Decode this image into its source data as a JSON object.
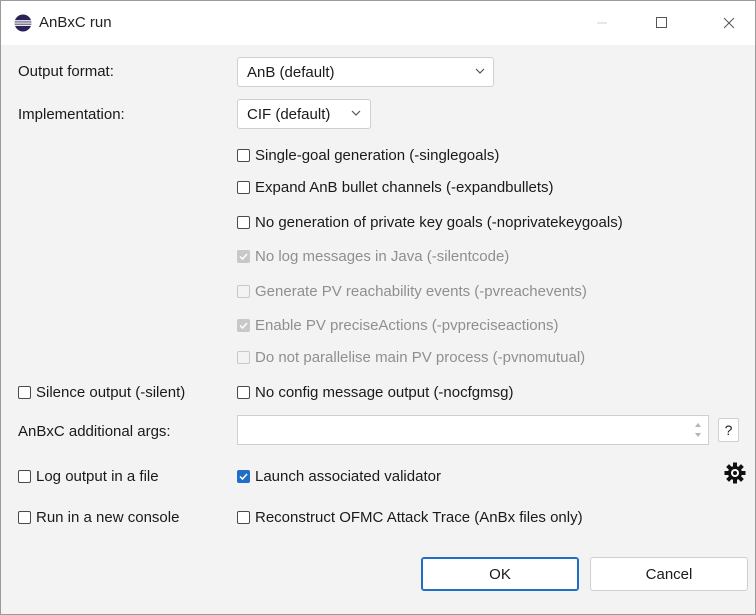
{
  "window": {
    "title": "AnBxC run",
    "icon": "eclipse-icon",
    "controls": [
      "minimize-icon",
      "maximize-icon",
      "close-icon"
    ]
  },
  "form": {
    "output_format": {
      "label": "Output format:",
      "value": "AnB (default)"
    },
    "implementation": {
      "label": "Implementation:",
      "value": "CIF (default)"
    },
    "options": [
      {
        "label": "Single-goal generation (-singlegoals)",
        "checked": false,
        "enabled": true
      },
      {
        "label": "Expand AnB bullet channels (-expandbullets)",
        "checked": false,
        "enabled": true
      },
      {
        "label": "No generation of private key goals (-noprivatekeygoals)",
        "checked": false,
        "enabled": true
      },
      {
        "label": "No log messages in Java (-silentcode)",
        "checked": true,
        "enabled": false
      },
      {
        "label": "Generate PV reachability events (-pvreachevents)",
        "checked": false,
        "enabled": false
      },
      {
        "label": "Enable PV preciseActions (-pvpreciseactions)",
        "checked": true,
        "enabled": false
      },
      {
        "label": "Do not parallelise main PV process (-pvnomutual)",
        "checked": false,
        "enabled": false
      }
    ],
    "silence_output": {
      "label": "Silence output (-silent)",
      "checked": false
    },
    "no_config_msg": {
      "label": "No config message output (-nocfgmsg)",
      "checked": false
    },
    "additional_args": {
      "label": "AnBxC additional args:",
      "value": ""
    },
    "help_button": "?",
    "log_output": {
      "label": "Log output in a file",
      "checked": false
    },
    "launch_validator": {
      "label": "Launch associated validator",
      "checked": true
    },
    "settings_icon": "gear-icon",
    "new_console": {
      "label": "Run in a new console",
      "checked": false
    },
    "reconstruct_trace": {
      "label": "Reconstruct OFMC Attack Trace (AnBx files only)",
      "checked": false
    }
  },
  "buttons": {
    "ok": "OK",
    "cancel": "Cancel"
  },
  "colors": {
    "accent": "#1f6fc9",
    "background": "#f3f3f3",
    "titlebar": "#ffffff"
  }
}
